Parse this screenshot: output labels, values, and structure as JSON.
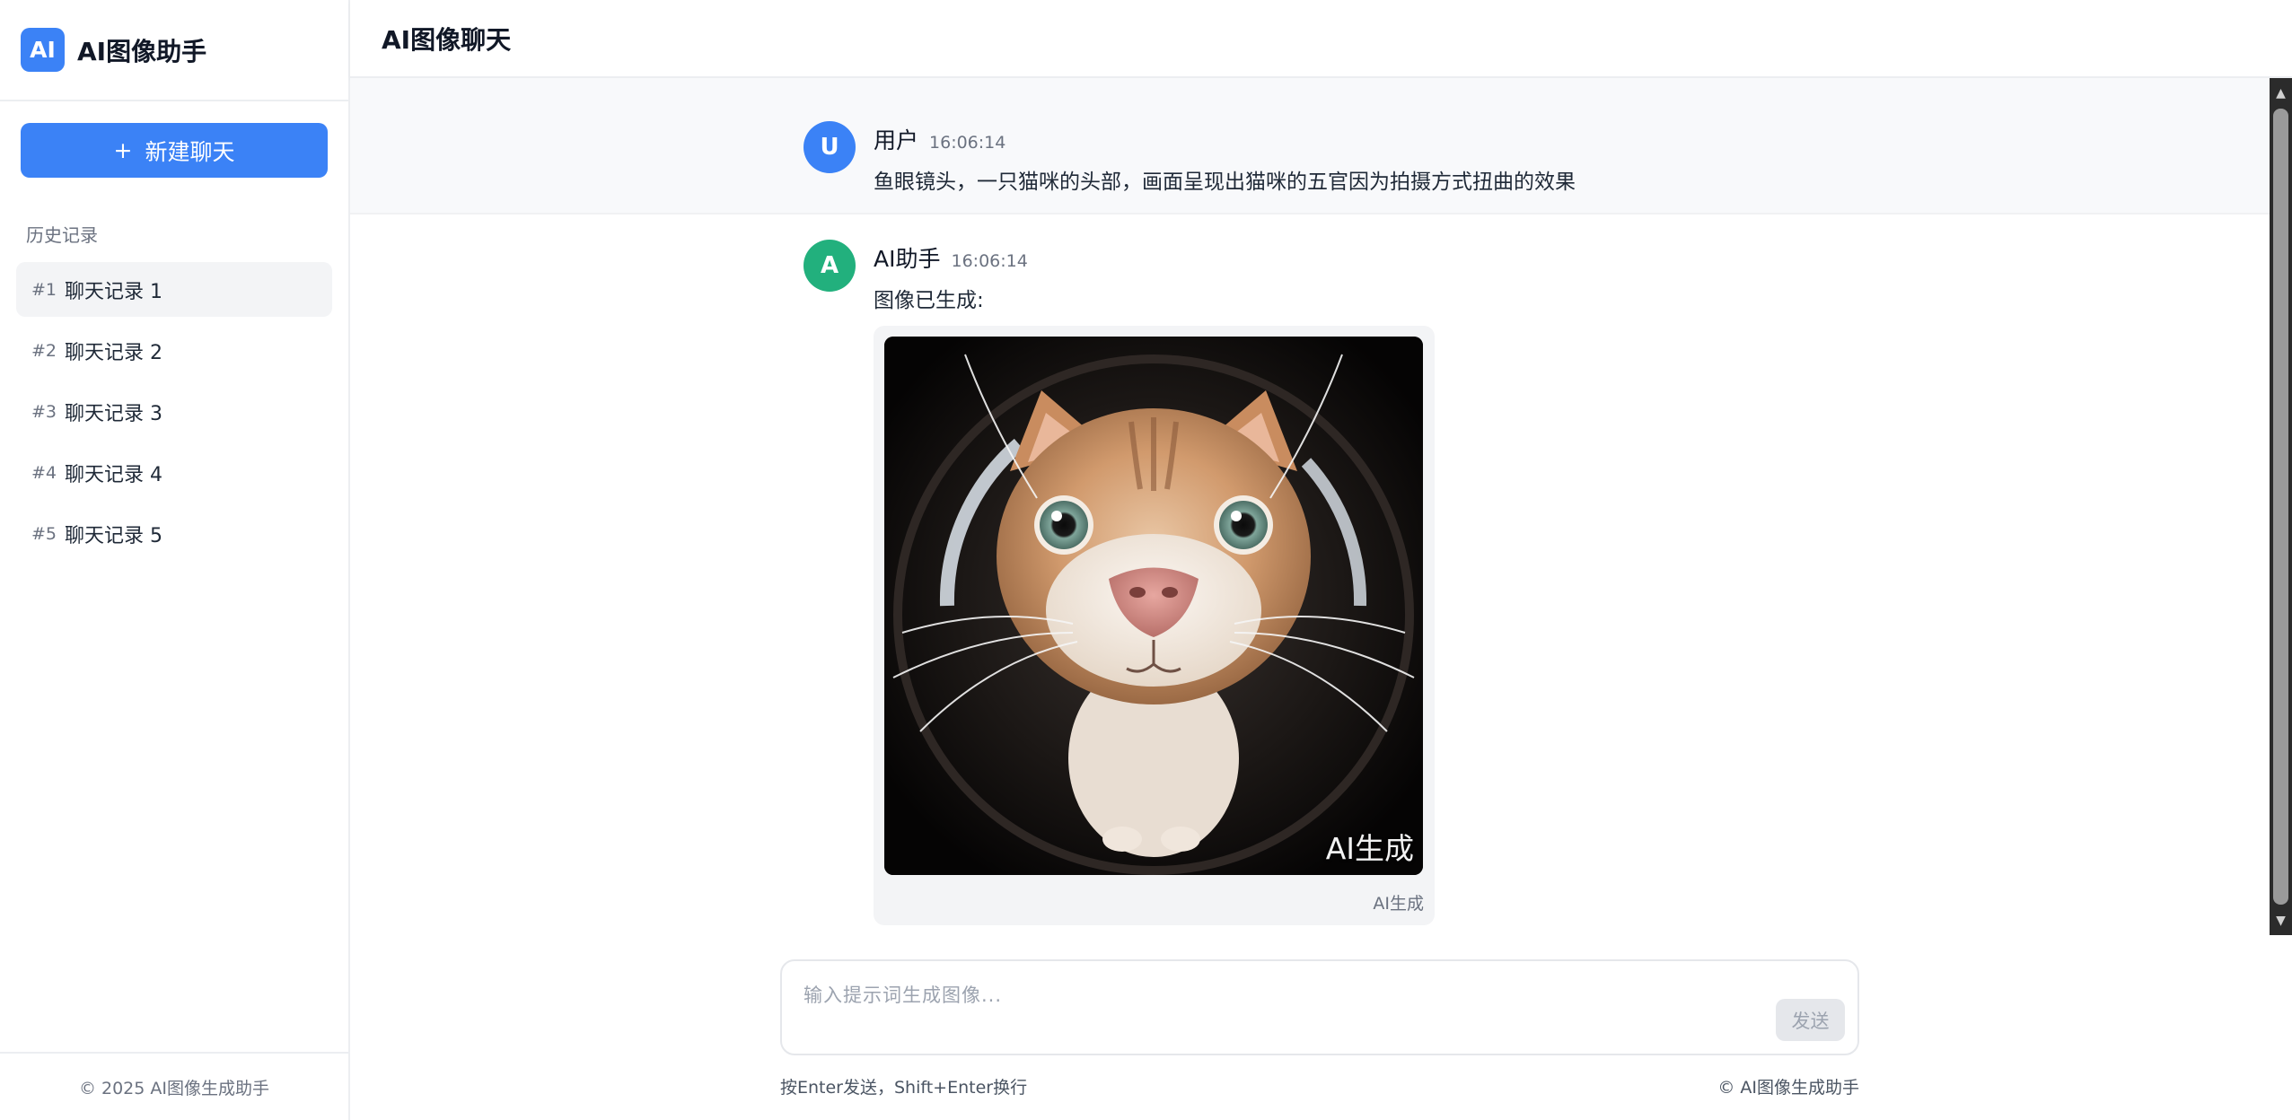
{
  "sidebar": {
    "logo_text": "AI",
    "brand_name": "AI图像助手",
    "new_chat_icon": "+",
    "new_chat_label": "新建聊天",
    "history_title": "历史记录",
    "items": [
      {
        "num": "#1",
        "label": "聊天记录 1",
        "active": true
      },
      {
        "num": "#2",
        "label": "聊天记录 2"
      },
      {
        "num": "#3",
        "label": "聊天记录 3"
      },
      {
        "num": "#4",
        "label": "聊天记录 4"
      },
      {
        "num": "#5",
        "label": "聊天记录 5"
      }
    ],
    "footer": "© 2025 AI图像生成助手"
  },
  "header": {
    "title": "AI图像聊天"
  },
  "messages": [
    {
      "role": "user",
      "avatar": "U",
      "sender": "用户",
      "time": "16:06:14",
      "text": "鱼眼镜头，一只猫咪的头部，画面呈现出猫咪的五官因为拍摄方式扭曲的效果"
    },
    {
      "role": "assistant",
      "avatar": "A",
      "sender": "AI助手",
      "time": "16:06:14",
      "text": "图像已生成:",
      "image_watermark": "AI生成",
      "image_caption": "AI生成"
    }
  ],
  "composer": {
    "placeholder": "输入提示词生成图像...",
    "send_label": "发送",
    "hint": "按Enter发送，Shift+Enter换行",
    "copyright": "© AI图像生成助手"
  },
  "colors": {
    "accent": "#3b82f6",
    "user_avatar": "#3b82f6",
    "ai_avatar": "#22b07d"
  },
  "icons": {
    "scroll_up": "scroll-up-arrow-icon",
    "scroll_down": "scroll-down-arrow-icon"
  }
}
